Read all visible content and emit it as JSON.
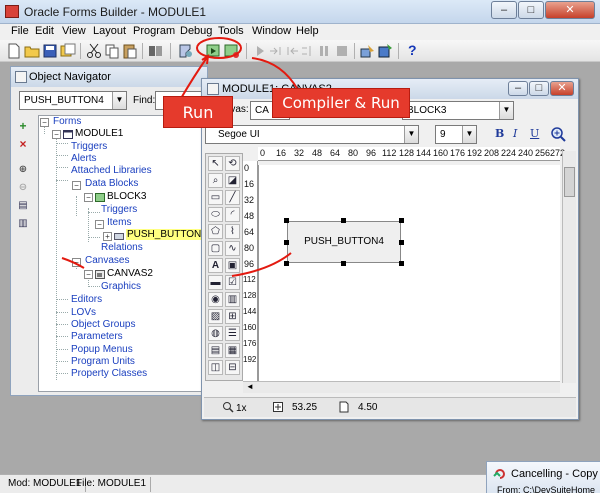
{
  "app": {
    "title": "Oracle Forms Builder - MODULE1",
    "window_buttons": {
      "minimize": "–",
      "maximize": "□",
      "close": "✕"
    }
  },
  "menu": [
    "File",
    "Edit",
    "View",
    "Layout",
    "Program",
    "Debug",
    "Tools",
    "Window",
    "Help"
  ],
  "toolbar": {
    "icons": [
      "new-icon",
      "open-icon",
      "save-icon",
      "save-all-icon",
      "cut-icon",
      "copy-icon",
      "paste-icon",
      "object-library-icon",
      "compile-icon",
      "run-icon",
      "debug-run-icon",
      "step-into-icon",
      "step-over-icon",
      "step-out-icon",
      "pause-icon",
      "stop-icon",
      "connect-icon",
      "wizard-icon",
      "help-icon"
    ],
    "help_label": "?"
  },
  "annotations": {
    "run": "Run",
    "compile_run": "Compiler & Run"
  },
  "navigator": {
    "title": "Object Navigator",
    "selector_value": "PUSH_BUTTON4",
    "find_label": "Find:",
    "side_buttons": [
      "+",
      "×",
      "⊕",
      "⊖",
      "▤",
      "▥"
    ],
    "tree": [
      {
        "label": "Forms",
        "level": 0
      },
      {
        "label": "MODULE1",
        "level": 1
      },
      {
        "label": "Triggers",
        "level": 2
      },
      {
        "label": "Alerts",
        "level": 2
      },
      {
        "label": "Attached Libraries",
        "level": 2
      },
      {
        "label": "Data Blocks",
        "level": 2
      },
      {
        "label": "BLOCK3",
        "level": 3
      },
      {
        "label": "Triggers",
        "level": 4
      },
      {
        "label": "Items",
        "level": 4
      },
      {
        "label": "PUSH_BUTTON4",
        "level": 5
      },
      {
        "label": "Relations",
        "level": 4
      },
      {
        "label": "Canvases",
        "level": 2
      },
      {
        "label": "CANVAS2",
        "level": 3
      },
      {
        "label": "Graphics",
        "level": 4
      },
      {
        "label": "Editors",
        "level": 2
      },
      {
        "label": "LOVs",
        "level": 2
      },
      {
        "label": "Object Groups",
        "level": 2
      },
      {
        "label": "Parameters",
        "level": 2
      },
      {
        "label": "Popup Menus",
        "level": 2
      },
      {
        "label": "Program Units",
        "level": 2
      },
      {
        "label": "Property Classes",
        "level": 2
      }
    ]
  },
  "canvas": {
    "title": "MODULE1: CANVAS2",
    "canvas_label": "Canvas:",
    "canvas_value": "CA",
    "block_value": "BLOCK3",
    "font_value": "Segoe UI",
    "size_value": "9",
    "format_buttons": [
      "B",
      "I",
      "U"
    ],
    "ruler_x": [
      "0",
      "16",
      "32",
      "48",
      "64",
      "80",
      "96",
      "112",
      "128",
      "144",
      "160",
      "176",
      "192",
      "208",
      "224",
      "240",
      "256",
      "272"
    ],
    "ruler_y": [
      "0",
      "16",
      "32",
      "48",
      "64",
      "80",
      "96",
      "112",
      "128",
      "144",
      "160",
      "176",
      "192"
    ],
    "button_label": "PUSH_BUTTON4",
    "zoom": "1x",
    "position": "53.25",
    "size_readout": "4.50"
  },
  "statusbar": {
    "mod": "Mod: MODULE1",
    "file": "File: MODULE1"
  },
  "popup": {
    "text": "Cancelling - Copy fro",
    "from": "From:  C:\\DevSuiteHome"
  }
}
